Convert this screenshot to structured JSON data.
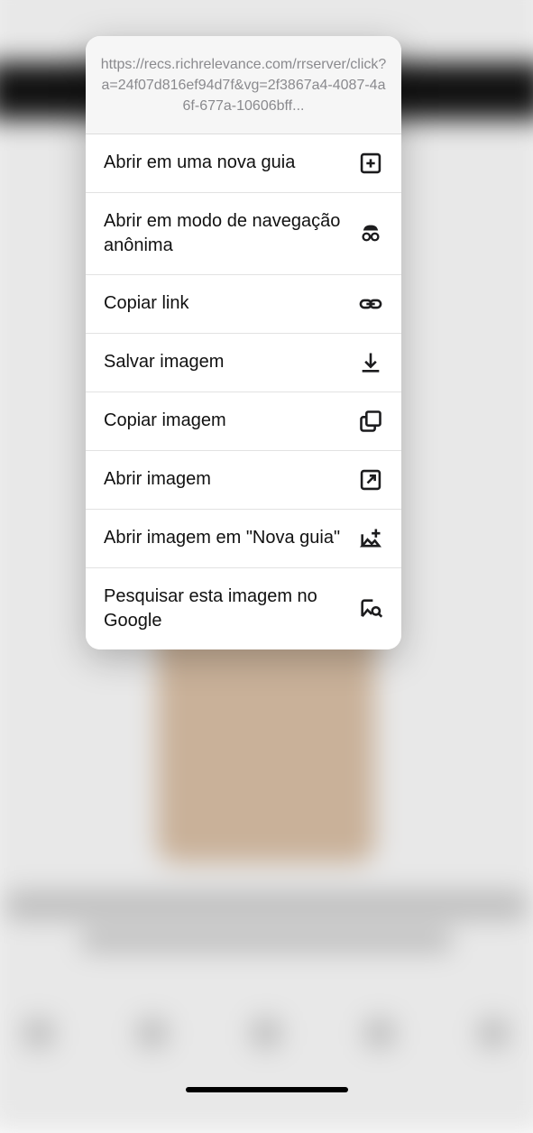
{
  "header": {
    "url": "https://recs.richrelevance.com/rrserver/click?a=24f07d816ef94d7f&vg=2f3867a4-4087-4a6f-677a-10606bff..."
  },
  "menu": {
    "items": [
      {
        "label": "Abrir em uma nova guia",
        "icon": "new-tab-icon"
      },
      {
        "label": "Abrir em modo de navegação anônima",
        "icon": "incognito-icon"
      },
      {
        "label": "Copiar link",
        "icon": "link-icon"
      },
      {
        "label": "Salvar imagem",
        "icon": "download-icon"
      },
      {
        "label": "Copiar imagem",
        "icon": "copy-icon"
      },
      {
        "label": "Abrir imagem",
        "icon": "open-external-icon"
      },
      {
        "label": "Abrir imagem em \"Nova guia\"",
        "icon": "image-new-tab-icon"
      },
      {
        "label": "Pesquisar esta imagem no Google",
        "icon": "image-search-icon"
      }
    ]
  }
}
